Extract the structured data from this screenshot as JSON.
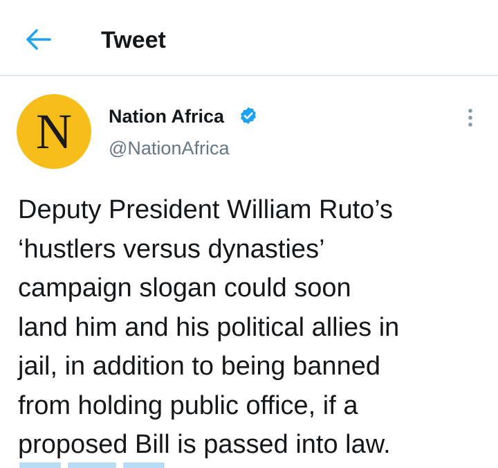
{
  "header": {
    "title": "Tweet",
    "back_icon": "back-arrow-icon",
    "accent_color": "#1da1f2"
  },
  "tweet": {
    "avatar_letter": "N",
    "avatar_color": "#f7bd1b",
    "display_name": "Nation Africa",
    "verified_icon": "verified-badge-icon",
    "handle": "@NationAfrica",
    "more_icon": "more-vertical-icon",
    "text": "Deputy President William Ruto’s\n‘hustlers versus dynasties’\ncampaign slogan could soon\nland him and his political allies in\njail, in addition to being banned\nfrom holding public office, if a\nproposed Bill is passed into law."
  }
}
